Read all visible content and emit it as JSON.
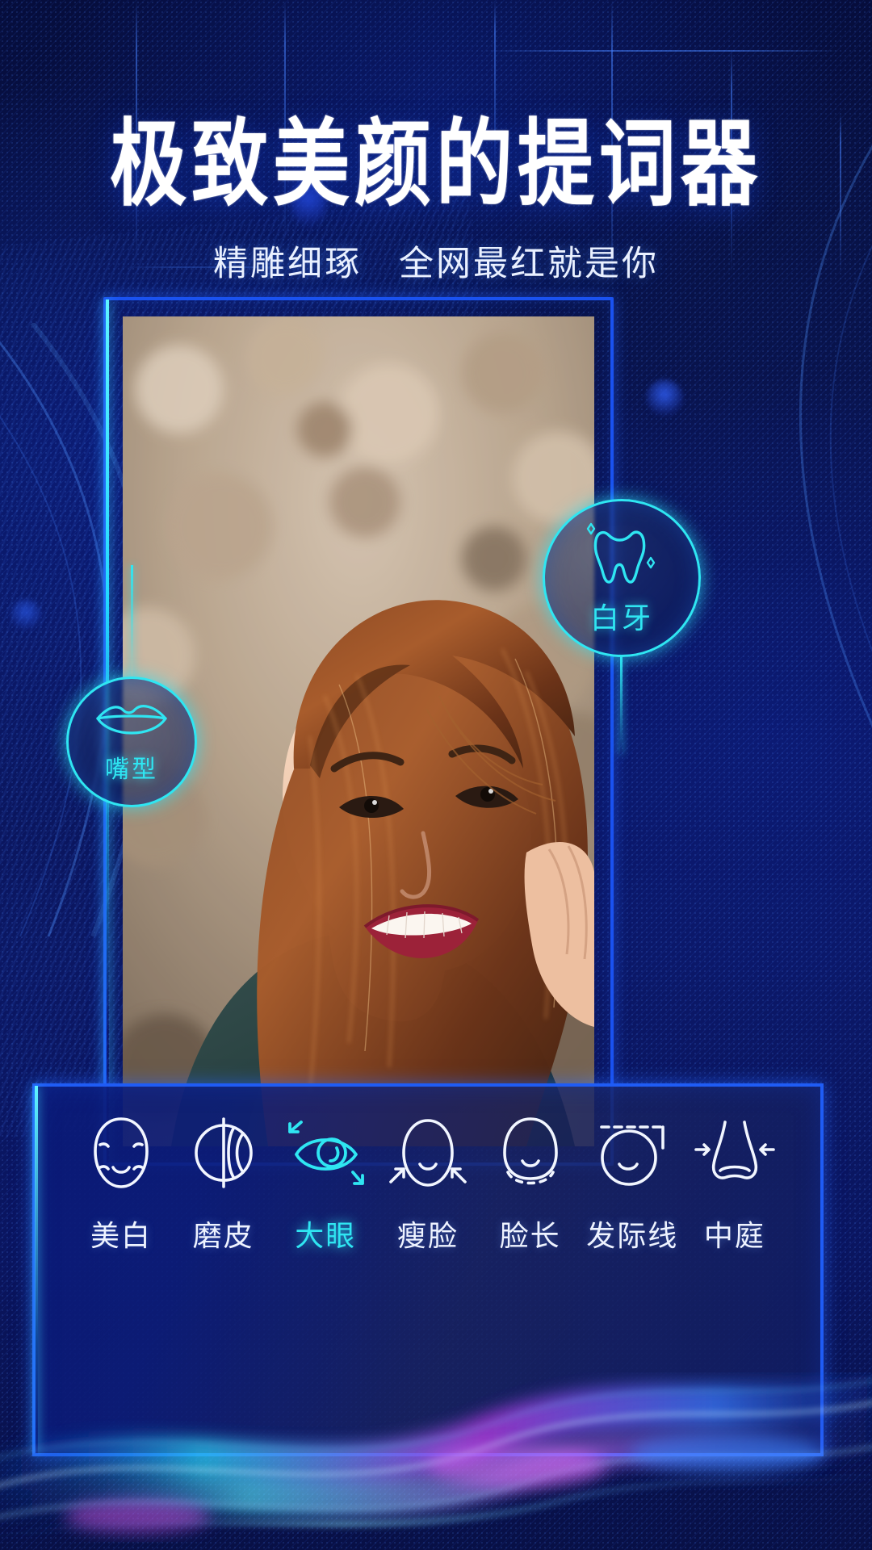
{
  "header": {
    "title": "极致美颜的提词器",
    "subtitle": "精雕细琢　全网最红就是你"
  },
  "colors": {
    "background_deep": "#060d3c",
    "background_mid": "#0b1763",
    "frame_blue": "#1a52f0",
    "accent_cyan": "#2fe6f2",
    "label_white": "#eef3ff"
  },
  "badges": [
    {
      "id": "teeth",
      "label": "白牙",
      "icon": "tooth-icon"
    },
    {
      "id": "mouth",
      "label": "嘴型",
      "icon": "lips-icon"
    }
  ],
  "toolbar": {
    "items": [
      {
        "label": "美白",
        "icon": "face-whiten-icon",
        "active": false
      },
      {
        "label": "磨皮",
        "icon": "skin-smooth-icon",
        "active": false
      },
      {
        "label": "大眼",
        "icon": "big-eye-icon",
        "active": true
      },
      {
        "label": "瘦脸",
        "icon": "slim-face-icon",
        "active": false
      },
      {
        "label": "脸长",
        "icon": "face-length-icon",
        "active": false
      },
      {
        "label": "发际线",
        "icon": "hairline-icon",
        "active": false
      },
      {
        "label": "中庭",
        "icon": "nose-midface-icon",
        "active": false
      }
    ]
  }
}
